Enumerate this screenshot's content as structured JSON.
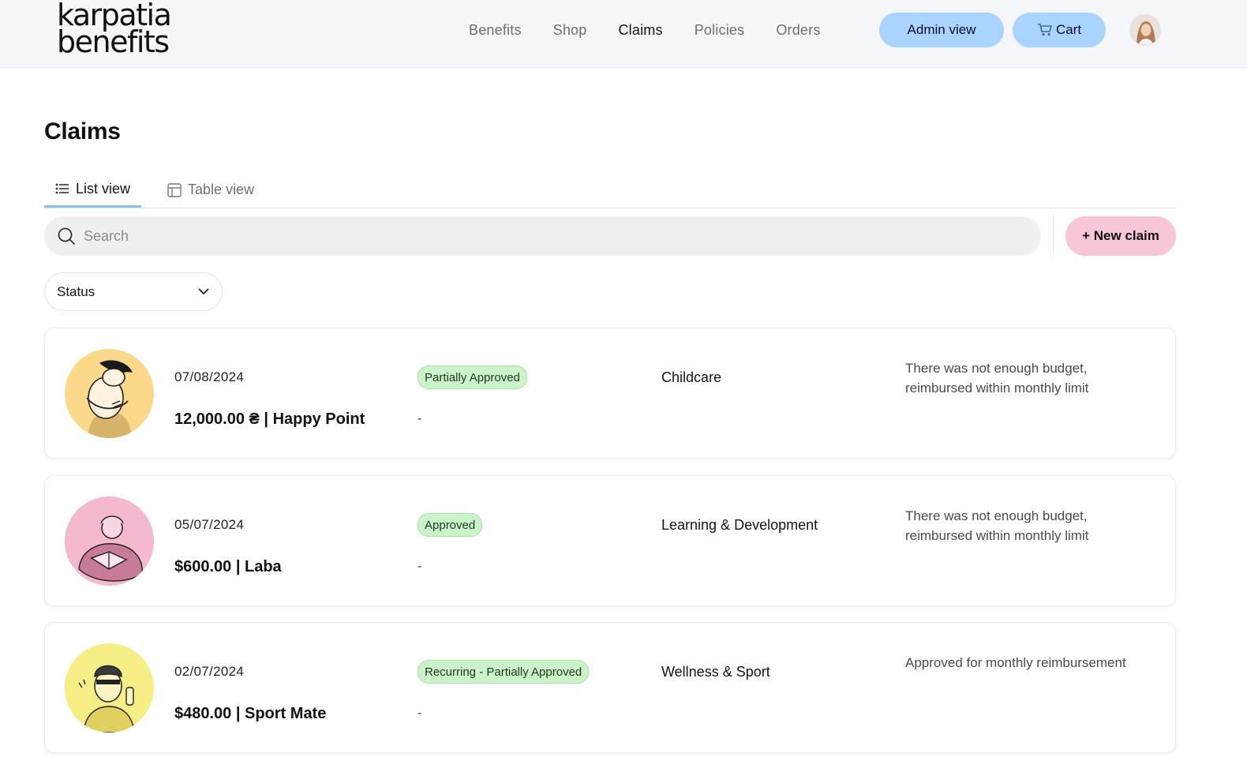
{
  "brand": {
    "line1": "karpatia",
    "line2": "benefits"
  },
  "nav": {
    "items": [
      {
        "label": "Benefits",
        "active": false
      },
      {
        "label": "Shop",
        "active": false
      },
      {
        "label": "Claims",
        "active": true
      },
      {
        "label": "Policies",
        "active": false
      },
      {
        "label": "Orders",
        "active": false
      }
    ],
    "admin_label": "Admin view",
    "cart_label": "Cart"
  },
  "page": {
    "title": "Claims"
  },
  "tabs": {
    "list": "List view",
    "table": "Table view"
  },
  "search": {
    "placeholder": "Search"
  },
  "new_claim_label": "+ New claim",
  "filter": {
    "status_label": "Status"
  },
  "claims": [
    {
      "date": "07/08/2024",
      "amount": "12,000.00 ₴ | Happy Point",
      "status": "Partially Approved",
      "detail": "-",
      "category": "Childcare",
      "note": "There was not enough budget, reimbursed within monthly limit",
      "illustration": "hug-illustration",
      "bg": "#fcd98a"
    },
    {
      "date": "05/07/2024",
      "amount": "$600.00 | Laba",
      "status": "Approved",
      "detail": "-",
      "category": "Learning & Development",
      "note": "There was not enough budget, reimbursed within monthly limit",
      "illustration": "reading-illustration",
      "bg": "#f4b9d1"
    },
    {
      "date": "02/07/2024",
      "amount": "$480.00 | Sport Mate",
      "status": "Recurring - Partially Approved",
      "detail": "-",
      "category": "Wellness & Sport",
      "note": "Approved for monthly reimbursement",
      "illustration": "sport-illustration",
      "bg": "#f8ee86"
    }
  ],
  "colors": {
    "header_bg": "#f5f6fa",
    "primary_button": "#a9d4ff",
    "new_claim": "#f7c6d9",
    "badge_green": "#ccf2c9",
    "tab_underline": "#8cbff0"
  }
}
